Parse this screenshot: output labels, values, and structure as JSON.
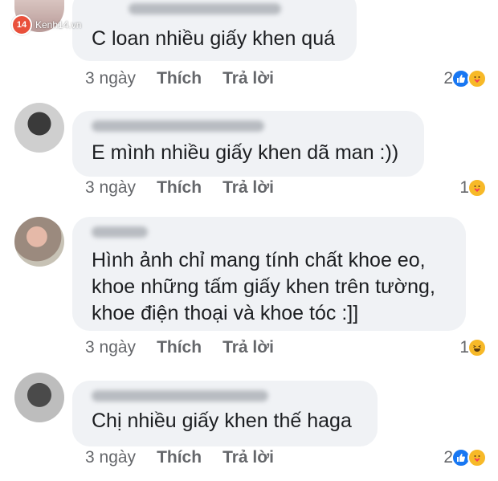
{
  "watermark": {
    "badge": "14",
    "text": "Kenh14.vn"
  },
  "colors": {
    "like": "#1877f2",
    "emoji": "#f7b928",
    "bubble": "#f0f2f5",
    "meta": "#65676b"
  },
  "comments": [
    {
      "text": "C loan nhiều giấy khen quá",
      "time": "3 ngày",
      "like_label": "Thích",
      "reply_label": "Trả lời",
      "reaction_count": "2",
      "reactions": [
        "like-icon",
        "care-icon"
      ]
    },
    {
      "text": "E mình nhiều giấy khen dã man :))",
      "time": "3 ngày",
      "like_label": "Thích",
      "reply_label": "Trả lời",
      "reaction_count": "1",
      "reactions": [
        "care-icon"
      ]
    },
    {
      "text_lines": [
        "Hình ảnh chỉ mang tính chất khoe eo,",
        "khoe những tấm giấy khen trên tường,",
        "khoe điện thoại và khoe tóc :]]"
      ],
      "time": "3 ngày",
      "like_label": "Thích",
      "reply_label": "Trả lời",
      "reaction_count": "1",
      "reactions": [
        "haha-icon"
      ]
    },
    {
      "text": "Chị nhiều giấy khen thế haga",
      "time": "3 ngày",
      "like_label": "Thích",
      "reply_label": "Trả lời",
      "reaction_count": "2",
      "reactions": [
        "like-icon",
        "care-icon"
      ]
    }
  ]
}
